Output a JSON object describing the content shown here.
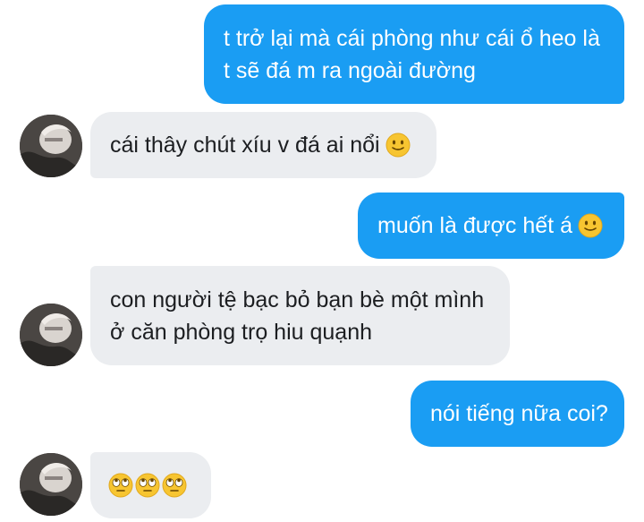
{
  "messages": [
    {
      "id": 1,
      "direction": "outgoing",
      "lines": [
        "t trở lại mà cái phòng như cái ổ heo là",
        "t sẽ đá m ra ngoài đường"
      ]
    },
    {
      "id": 2,
      "direction": "incoming",
      "lines": [
        "cái thây chút xíu v đá ai nổi"
      ],
      "emoji": "slight-smile"
    },
    {
      "id": 3,
      "direction": "outgoing",
      "lines": [
        "muốn là được hết á"
      ],
      "emoji": "slight-smile"
    },
    {
      "id": 4,
      "direction": "incoming",
      "lines": [
        "con người tệ bạc bỏ bạn bè một mình",
        "ở căn phòng trọ hiu quạnh"
      ]
    },
    {
      "id": 5,
      "direction": "outgoing",
      "lines": [
        "nói tiếng nữa coi?"
      ]
    },
    {
      "id": 6,
      "direction": "incoming",
      "lines": [],
      "emoji": "rolling-eyes",
      "emoji_count": 3
    }
  ],
  "colors": {
    "outgoing_bubble": "#1a9df3",
    "incoming_bubble": "#ebedf0",
    "emoji_face": "#f7c531"
  }
}
